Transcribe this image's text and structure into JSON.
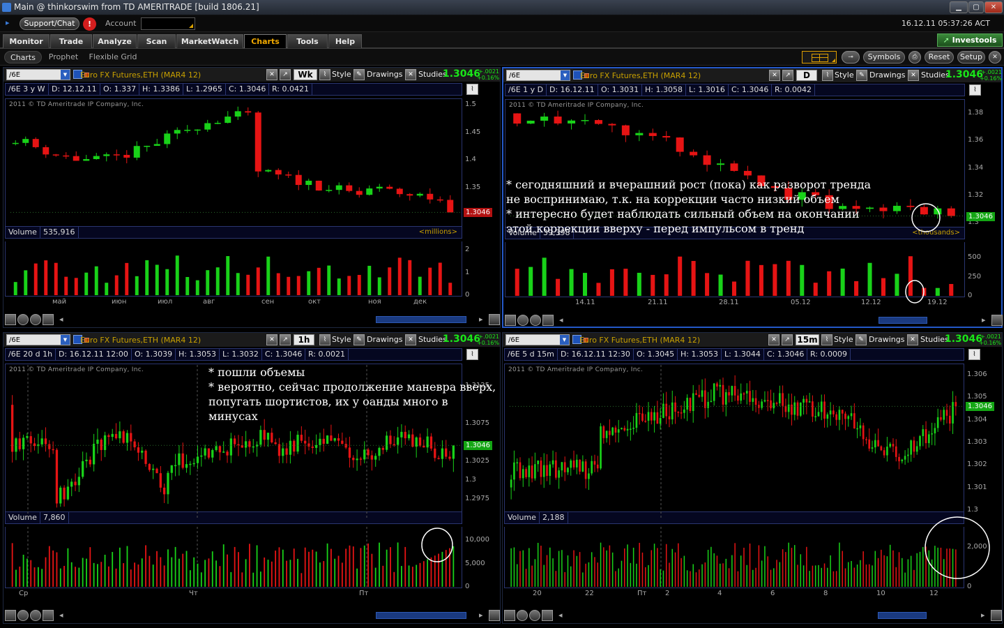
{
  "window": {
    "title": "Main @ thinkorswim from TD AMERITRADE [build 1806.21]"
  },
  "account_bar": {
    "support_label": "Support/Chat",
    "alert_label": "!",
    "account_label": "Account",
    "datetime": "16.12.11 05:37:26 ACT"
  },
  "nav_tabs": [
    "Monitor",
    "Trade",
    "Analyze",
    "Scan",
    "MarketWatch",
    "Charts",
    "Tools",
    "Help"
  ],
  "active_nav": "Charts",
  "investools_label": "Investools",
  "sub_tabs": [
    "Charts",
    "Prophet",
    "Flexible Grid"
  ],
  "toolbar_buttons": {
    "symbols": "Symbols",
    "reset": "Reset",
    "setup": "Setup"
  },
  "colors": {
    "up": "#19d219",
    "down": "#e61414",
    "accent": "#f0a800",
    "info_bg": "#050720",
    "border": "#2a3570"
  },
  "panels": [
    {
      "symbol": "/6E",
      "description": "Euro FX Futures,ETH (MAR4 12)",
      "period": "Wk",
      "labels": {
        "style": "Style",
        "drawings": "Drawings",
        "studies": "Studies"
      },
      "price": "1.3046",
      "change": "+.0021",
      "change_pct": "+0.16%",
      "info": {
        "range": "/6E 3 y W",
        "date": "D: 12.12.11",
        "open": "O: 1.337",
        "high": "H: 1.3386",
        "low": "L: 1.2965",
        "close": "C: 1.3046",
        "r": "R: 0.0421"
      },
      "copyright": "2011 © TD Ameritrade IP Company, Inc.",
      "volume_label": "Volume",
      "volume_value": "535,916",
      "volume_unit": "<millions>",
      "price_axis": [
        "1.5",
        "1.45",
        "1.4",
        "1.35"
      ],
      "volume_axis": [
        "2",
        "1",
        "0"
      ],
      "x_labels": [
        "май",
        "июн",
        "июл",
        "авг",
        "сен",
        "окт",
        "ноя",
        "дек"
      ],
      "last_price_tag": "1.3046",
      "annotation": []
    },
    {
      "symbol": "/6E",
      "description": "Euro FX Futures,ETH (MAR4 12)",
      "period": "D",
      "labels": {
        "style": "Style",
        "drawings": "Drawings",
        "studies": "Studies"
      },
      "price": "1.3046",
      "change": "+.0021",
      "change_pct": "+0.16%",
      "info": {
        "range": "/6E 1 y D",
        "date": "D: 16.12.11",
        "open": "O: 1.3031",
        "high": "H: 1.3058",
        "low": "L: 1.3016",
        "close": "C: 1.3046",
        "r": "R: 0.0042"
      },
      "copyright": "2011 © TD Ameritrade IP Company, Inc.",
      "volume_label": "Volume",
      "volume_value": "39,398",
      "volume_unit": "<thousands>",
      "price_axis": [
        "1.38",
        "1.36",
        "1.34",
        "1.32",
        "1.3"
      ],
      "volume_axis": [
        "500",
        "250",
        "0"
      ],
      "x_labels": [
        "14.11",
        "21.11",
        "28.11",
        "05.12",
        "12.12",
        "19.12"
      ],
      "last_price_tag": "1.3046",
      "annotation": [
        "* сегодняшний и вчерашний рост (пока) как разворот тренда",
        "не воспринимаю, т.к. на коррекции часто низкий объем",
        "* интересно будет наблюдать сильный объем на окончании",
        "этой коррекции вверху - перед импульсом в тренд"
      ]
    },
    {
      "symbol": "/6E",
      "description": "Euro FX Futures,ETH (MAR4 12)",
      "period": "1h",
      "labels": {
        "style": "Style",
        "drawings": "Drawings",
        "studies": "Studies"
      },
      "price": "1.3046",
      "change": "+.0021",
      "change_pct": "+0.16%",
      "info": {
        "range": "/6E 20 d 1h",
        "date": "D: 16.12.11 12:00",
        "open": "O: 1.3039",
        "high": "H: 1.3053",
        "low": "L: 1.3032",
        "close": "C: 1.3046",
        "r": "R: 0.0021"
      },
      "copyright": "2011 © TD Ameritrade IP Company, Inc.",
      "volume_label": "Volume",
      "volume_value": "7,860",
      "volume_unit": "",
      "price_axis": [
        "1.3125",
        "1.3075",
        "1.3025",
        "1.3",
        "1.2975"
      ],
      "volume_axis": [
        "10,000",
        "5,000",
        "0"
      ],
      "x_labels": [
        "Ср",
        "Чт",
        "Пт"
      ],
      "last_price_tag": "1.3046",
      "annotation": [
        "* пошли объемы",
        "* вероятно, сейчас продолжение маневра вверх,",
        "попугать шортистов, их у оанды много в",
        "минусах"
      ]
    },
    {
      "symbol": "/6E",
      "description": "Euro FX Futures,ETH (MAR4 12)",
      "period": "15m",
      "labels": {
        "style": "Style",
        "drawings": "Drawings",
        "studies": "Studies"
      },
      "price": "1.3046",
      "change": "+.0021",
      "change_pct": "+0.16%",
      "info": {
        "range": "/6E 5 d 15m",
        "date": "D: 16.12.11 12:30",
        "open": "O: 1.3045",
        "high": "H: 1.3053",
        "low": "L: 1.3044",
        "close": "C: 1.3046",
        "r": "R: 0.0009"
      },
      "copyright": "2011 © TD Ameritrade IP Company, Inc.",
      "volume_label": "Volume",
      "volume_value": "2,188",
      "volume_unit": "",
      "price_axis": [
        "1.306",
        "1.305",
        "1.304",
        "1.303",
        "1.302",
        "1.301",
        "1.3"
      ],
      "volume_axis": [
        "2,000",
        "0"
      ],
      "x_labels": [
        "20",
        "22",
        "Пт",
        "2",
        "4",
        "6",
        "8",
        "10",
        "12"
      ],
      "last_price_tag": "1.3046",
      "annotation": []
    }
  ]
}
